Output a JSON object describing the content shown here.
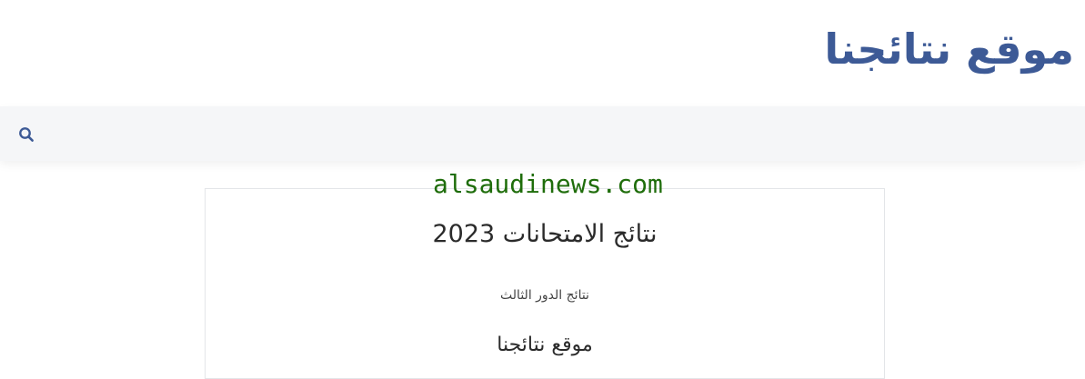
{
  "header": {
    "site_title": "موقع نتائجنا",
    "title_color": "#3d5a96"
  },
  "nav": {
    "search_icon": "search-icon",
    "background": "#f5f6f8"
  },
  "watermark": {
    "text": "alsaudinews.com",
    "color": "#1f6d0b"
  },
  "card": {
    "heading": "نتائج الامتحانات 2023",
    "link": "نتائج الدور الثالث",
    "subheading": "موقع نتائجنا"
  }
}
